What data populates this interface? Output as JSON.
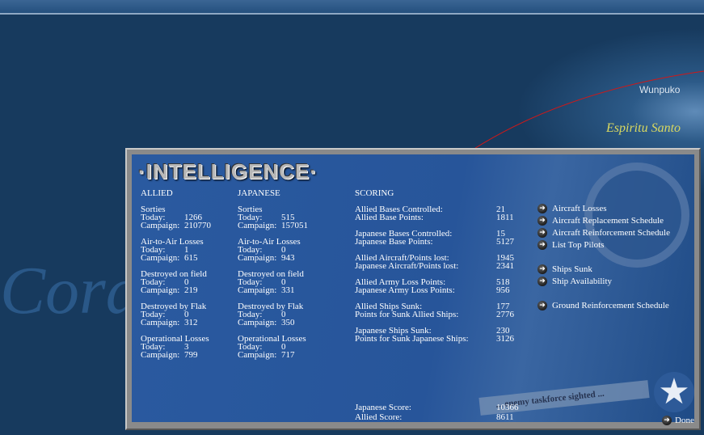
{
  "map": {
    "labels": {
      "coral": "Coral",
      "wunpuko": "Wunpuko",
      "santo": "Espiritu Santo"
    }
  },
  "panel": {
    "title": "·INTELLIGENCE·",
    "allied": {
      "header": "ALLIED",
      "groups": [
        {
          "name": "Sorties",
          "today": "1266",
          "campaign": "210770"
        },
        {
          "name": "Air-to-Air Losses",
          "today": "1",
          "campaign": "615"
        },
        {
          "name": "Destroyed on field",
          "today": "0",
          "campaign": "219"
        },
        {
          "name": "Destroyed by Flak",
          "today": "0",
          "campaign": "312"
        },
        {
          "name": "Operational Losses",
          "today": "3",
          "campaign": "799"
        }
      ]
    },
    "japanese": {
      "header": "JAPANESE",
      "groups": [
        {
          "name": "Sorties",
          "today": "515",
          "campaign": "157051"
        },
        {
          "name": "Air-to-Air Losses",
          "today": "0",
          "campaign": "943"
        },
        {
          "name": "Destroyed on field",
          "today": "0",
          "campaign": "331"
        },
        {
          "name": "Destroyed by Flak",
          "today": "0",
          "campaign": "350"
        },
        {
          "name": "Operational Losses",
          "today": "0",
          "campaign": "717"
        }
      ]
    },
    "today_label": "Today:",
    "campaign_label": "Campaign:",
    "scoring": {
      "header": "SCORING",
      "rows": [
        [
          {
            "label": "Allied Bases Controlled:",
            "value": "21"
          },
          {
            "label": "Allied Base Points:",
            "value": "1811"
          }
        ],
        [
          {
            "label": "Japanese Bases Controlled:",
            "value": "15"
          },
          {
            "label": "Japanese Base Points:",
            "value": "5127"
          }
        ],
        [
          {
            "label": "Allied Aircraft/Points lost:",
            "value": "1945"
          },
          {
            "label": "Japanese Aircraft/Points lost:",
            "value": "2341"
          }
        ],
        [
          {
            "label": "Allied Army Loss Points:",
            "value": "518"
          },
          {
            "label": "Japanese Army Loss Points:",
            "value": "956"
          }
        ],
        [
          {
            "label": "Allied Ships Sunk:",
            "value": "177"
          },
          {
            "label": "Points for Sunk Allied Ships:",
            "value": "2776"
          }
        ],
        [
          {
            "label": "Japanese Ships Sunk:",
            "value": "230"
          },
          {
            "label": "Points for Sunk Japanese Ships:",
            "value": "3126"
          }
        ]
      ],
      "japanese_score_label": "Japanese Score:",
      "japanese_score": "10366",
      "allied_score_label": "Allied Score:",
      "allied_score": "8611"
    },
    "links": [
      "Aircraft Losses",
      "Aircraft Replacement Schedule",
      "Aircraft Reinforcement Schedule",
      "List Top Pilots",
      "Ships Sunk",
      "Ship Availability",
      "Ground Reinforcement Schedule"
    ],
    "decor_text": "... enemy taskforce sighted ...",
    "done": "Done"
  }
}
